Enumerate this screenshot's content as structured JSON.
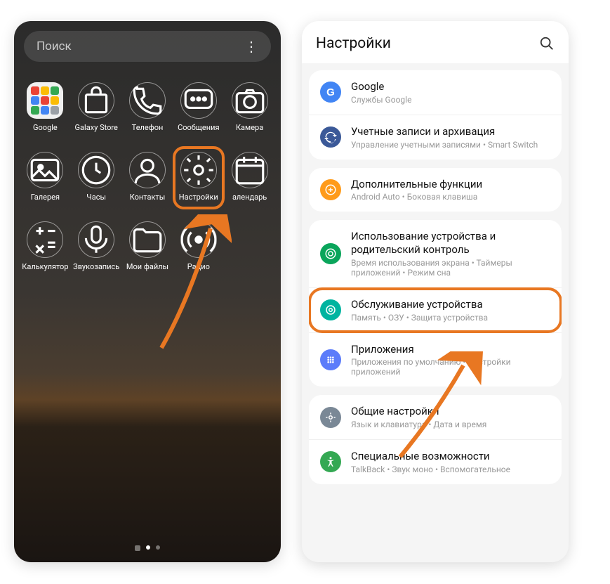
{
  "left": {
    "search_placeholder": "Поиск",
    "apps": [
      {
        "label": "Google",
        "icon": "folder"
      },
      {
        "label": "Galaxy Store",
        "icon": "bag"
      },
      {
        "label": "Телефон",
        "icon": "phone"
      },
      {
        "label": "Сообщения",
        "icon": "chat"
      },
      {
        "label": "Камера",
        "icon": "camera"
      },
      {
        "label": "Галерея",
        "icon": "gallery"
      },
      {
        "label": "Часы",
        "icon": "clock"
      },
      {
        "label": "Контакты",
        "icon": "contact"
      },
      {
        "label": "Настройки",
        "icon": "gear",
        "highlight": true
      },
      {
        "label": "алендарь",
        "icon": "calendar"
      },
      {
        "label": "Калькулятор",
        "icon": "calc"
      },
      {
        "label": "Звукозапись",
        "icon": "mic"
      },
      {
        "label": "Мои файлы",
        "icon": "folder2"
      },
      {
        "label": "Радио",
        "icon": "radio"
      }
    ]
  },
  "right": {
    "header_title": "Настройки",
    "groups": [
      [
        {
          "icon_bg": "#4285F4",
          "glyph": "G",
          "title": "Google",
          "sub": "Службы Google"
        },
        {
          "icon_bg": "#3b5998",
          "glyph": "sync",
          "title": "Учетные записи и архивация",
          "sub": "Управление учетными записями  •  Smart Switch"
        }
      ],
      [
        {
          "icon_bg": "#ff9b1a",
          "glyph": "plus",
          "title": "Дополнительные функции",
          "sub": "Android Auto  •  Боковая клавиша"
        }
      ],
      [
        {
          "icon_bg": "#0aa55b",
          "glyph": "wellbeing",
          "title": "Использование устройства и родительский контроль",
          "sub": "Время использования экрана  •  Таймеры приложений  •  Режим сна"
        },
        {
          "icon_bg": "#00b4a0",
          "glyph": "care",
          "title": "Обслуживание устройства",
          "sub": "Память  •  ОЗУ  •  Защита устройства",
          "highlight": true
        },
        {
          "icon_bg": "#5c7cfa",
          "glyph": "apps",
          "title": "Приложения",
          "sub": "Приложения по умолчанию  •  Настройки приложений"
        }
      ],
      [
        {
          "icon_bg": "#7a8896",
          "glyph": "general",
          "title": "Общие настройки",
          "sub": "Язык и клавиатура  •  Дата и время"
        },
        {
          "icon_bg": "#34a853",
          "glyph": "access",
          "title": "Специальные возможности",
          "sub": "TalkBack  •  Звук моно  •  Вспомогательное"
        }
      ]
    ]
  },
  "colors": {
    "highlight": "#e87722"
  }
}
